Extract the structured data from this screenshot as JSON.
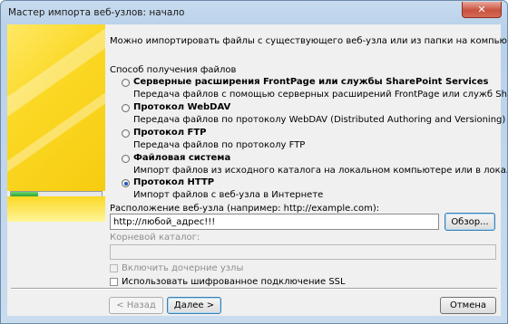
{
  "window": {
    "title": "Мастер импорта веб-узлов: начало"
  },
  "intro": "Можно импортировать файлы с существующего веб-узла или из папки на компьютере или в сети.",
  "method_label": "Способ получения файлов",
  "options": [
    {
      "label": "Серверные расширения FrontPage или службы SharePoint Services",
      "description": "Передача файлов с помощью серверных расширений FrontPage или служб SharePoint Services",
      "checked": false
    },
    {
      "label": "Протокол WebDAV",
      "description": "Передача файлов по протоколу WebDAV (Distributed Authoring and Versioning)",
      "checked": false
    },
    {
      "label": "Протокол FTP",
      "description": "Передача файлов по протоколу FTP",
      "checked": false
    },
    {
      "label": "Файловая система",
      "description": "Импорт файлов из исходного каталога на локальном компьютере или в локальной сети",
      "checked": false
    },
    {
      "label": "Протокол HTTP",
      "description": "Импорт файлов с веб-узла в Интернете",
      "checked": true
    }
  ],
  "location": {
    "label": "Расположение веб-узла (например: http://example.com):",
    "value": "http://любой_адрес!!!",
    "browse": "Обзор..."
  },
  "root": {
    "label": "Корневой каталог:",
    "value": ""
  },
  "include_subsites": {
    "label": "Включить дочерние узлы",
    "checked": false
  },
  "use_ssl": {
    "label": "Использовать шифрованное подключение SSL",
    "checked": false
  },
  "buttons": {
    "back": "< Назад",
    "next": "Далее >",
    "cancel": "Отмена"
  },
  "progress": 0.3
}
